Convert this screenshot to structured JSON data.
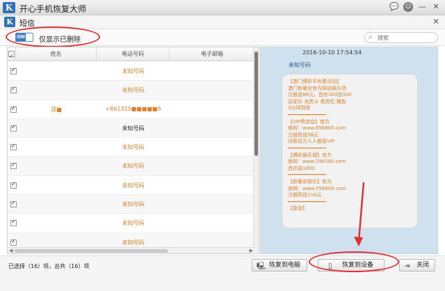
{
  "window": {
    "title": "开心手机恢复大师",
    "logo_letter": "K",
    "icons": [
      "chat-icon",
      "feedback-icon",
      "minimize-icon",
      "close-icon"
    ]
  },
  "subheader": {
    "logo_letter": "K",
    "title": "短信"
  },
  "toolbar": {
    "toggle_state": "ON",
    "toggle_label": "仅显示已删除",
    "search_placeholder": "搜索"
  },
  "table": {
    "columns": [
      "姓名",
      "电话号码",
      "电子邮箱"
    ],
    "rows": [
      {
        "name": "",
        "phone": "未知号码",
        "style": "orange"
      },
      {
        "name": "",
        "phone": "未知号码",
        "style": "orange"
      },
      {
        "name": "邵■",
        "phone": "+861315■■■■■5",
        "style": "orange"
      },
      {
        "name": "",
        "phone": "未知号码",
        "style": "dark"
      },
      {
        "name": "",
        "phone": "未知号码",
        "style": "orange"
      },
      {
        "name": "",
        "phone": "未知号码",
        "style": "orange"
      },
      {
        "name": "",
        "phone": "未知号码",
        "style": "orange"
      },
      {
        "name": "",
        "phone": "未知号码",
        "style": "orange"
      },
      {
        "name": "",
        "phone": "未知号码",
        "style": "orange"
      },
      {
        "name": "",
        "phone": "未知号码",
        "style": "orange"
      }
    ]
  },
  "message": {
    "time": "2016-10-10 17:54:54",
    "sender": "未知号码",
    "lines": [
      "【澳门博彩平优惠活动】",
      "澳门新葡京官方网站娱乐场",
      "注册送88元，首存300送300",
      "百家乐 龙虎斗 老虎机 捕鱼",
      "3分钟到账",
      "━━━━━━━━━━━━━",
      "【VIP贵宾会】官方",
      "官网：www.656800.com",
      "注册即送38元",
      "月薪百万人人都是VIP",
      "━━━━━━━━━━━━━",
      "【博彩娱乐城】官方",
      "官网：www.296580.com",
      "首存送1000",
      "━━━━━━━━━━━━━",
      "【新葡京娱乐】官方",
      "官网：www.756809.com",
      "注册即送118元",
      "━━━━━━━━━━━━━",
      "【急急】"
    ]
  },
  "status": {
    "text": "已选择（16）项，总共（16）项"
  },
  "buttons": {
    "restore_pc": "恢复到电脑",
    "restore_device": "恢复到设备",
    "close": "关闭"
  },
  "colors": {
    "accent": "#2f6fb8",
    "highlight_red": "#e03030",
    "row_text_orange": "#e0802c",
    "preview_bg": "#cfe0ef"
  }
}
